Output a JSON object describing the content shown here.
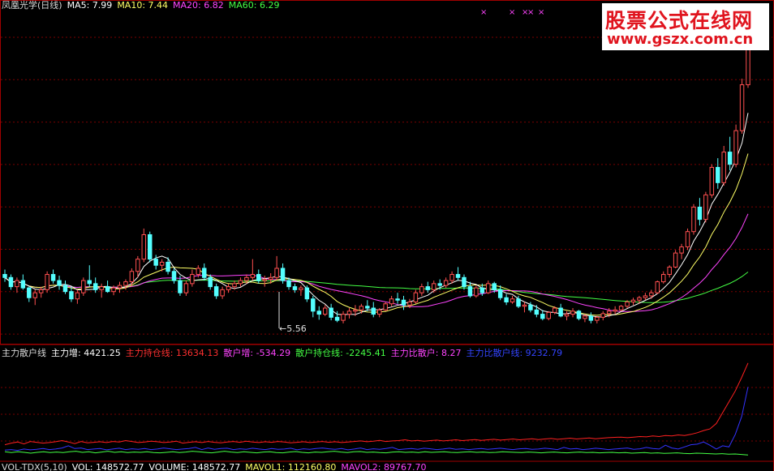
{
  "colors": {
    "background": "#000000",
    "grid": "#7a0000",
    "frame": "#a00000",
    "up": "#ff5050",
    "down": "#54ffff",
    "ma5": "#ffffff",
    "ma10": "#ffff66",
    "ma20": "#ff44ff",
    "ma60": "#44ff44",
    "ind_main": "#ff2020",
    "ind_retail": "#44ff44",
    "ind_blue": "#3333ff"
  },
  "header": {
    "title": "凤凰光学(日线)",
    "ma5": "MA5: 7.99",
    "ma10": "MA10: 7.44",
    "ma20": "MA20: 6.82",
    "ma60": "MA60: 6.29"
  },
  "markers": [
    "×",
    "×",
    "×",
    "×",
    "×"
  ],
  "watermark": {
    "line1": "股票公式在线网",
    "line2": "www.gszx.com.cn"
  },
  "low_label": "←5.56",
  "indicator_header": {
    "name": "主力散户线",
    "main_inc": "主力增: 4421.25",
    "main_hold": "主力持仓线: 13634.13",
    "retail_inc": "散户增: -534.29",
    "retail_hold": "散户持仓线: -2245.41",
    "ratio": "主力比散户: 8.27",
    "ratio_line": "主力比散户线: 9232.79"
  },
  "volume_header": {
    "name": "VOL-TDX(5,10)",
    "vol": "VOL: 148572.77",
    "volume": "VOLUME: 148572.77",
    "mavol1": "MAVOL1: 112160.80",
    "mavol2": "MAVOL2: 89767.70"
  },
  "chart_data": [
    {
      "type": "candlestick",
      "title": "凤凰光学(日线)",
      "y_unit": "price",
      "annotations": [
        "←5.56"
      ],
      "ma_values": {
        "MA5": 7.99,
        "MA10": 7.44,
        "MA20": 6.82,
        "MA60": 6.29
      },
      "low_marked": 5.56,
      "candles_ohlc": [
        [
          6.3,
          6.38,
          6.18,
          6.25
        ],
        [
          6.25,
          6.3,
          6.05,
          6.1
        ],
        [
          6.1,
          6.25,
          6.0,
          6.2
        ],
        [
          6.2,
          6.3,
          6.05,
          6.08
        ],
        [
          6.08,
          6.1,
          5.85,
          5.92
        ],
        [
          5.92,
          6.05,
          5.8,
          6.0
        ],
        [
          6.0,
          6.1,
          5.92,
          6.05
        ],
        [
          6.05,
          6.35,
          6.0,
          6.3
        ],
        [
          6.3,
          6.38,
          6.15,
          6.2
        ],
        [
          6.2,
          6.28,
          6.05,
          6.12
        ],
        [
          6.12,
          6.2,
          5.98,
          6.02
        ],
        [
          6.02,
          6.1,
          5.85,
          5.9
        ],
        [
          5.9,
          6.05,
          5.82,
          6.0
        ],
        [
          6.0,
          6.25,
          5.95,
          6.2
        ],
        [
          6.2,
          6.45,
          6.1,
          6.15
        ],
        [
          6.15,
          6.25,
          6.0,
          6.05
        ],
        [
          6.05,
          6.15,
          5.92,
          6.1
        ],
        [
          6.1,
          6.2,
          6.0,
          6.02
        ],
        [
          6.02,
          6.12,
          5.96,
          6.08
        ],
        [
          6.08,
          6.18,
          6.0,
          6.12
        ],
        [
          6.12,
          6.22,
          6.05,
          6.18
        ],
        [
          6.18,
          6.4,
          6.1,
          6.35
        ],
        [
          6.35,
          6.6,
          6.25,
          6.55
        ],
        [
          6.55,
          7.05,
          6.5,
          6.95
        ],
        [
          6.95,
          7.0,
          6.5,
          6.55
        ],
        [
          6.55,
          6.62,
          6.38,
          6.45
        ],
        [
          6.45,
          6.55,
          6.35,
          6.5
        ],
        [
          6.5,
          6.58,
          6.3,
          6.35
        ],
        [
          6.35,
          6.4,
          6.15,
          6.2
        ],
        [
          6.2,
          6.28,
          5.95,
          6.0
        ],
        [
          6.0,
          6.2,
          5.95,
          6.15
        ],
        [
          6.15,
          6.38,
          6.1,
          6.3
        ],
        [
          6.3,
          6.45,
          6.25,
          6.4
        ],
        [
          6.4,
          6.48,
          6.2,
          6.25
        ],
        [
          6.25,
          6.3,
          6.05,
          6.1
        ],
        [
          6.1,
          6.15,
          5.9,
          5.95
        ],
        [
          5.95,
          6.1,
          5.9,
          6.05
        ],
        [
          6.05,
          6.15,
          6.0,
          6.1
        ],
        [
          6.1,
          6.2,
          6.05,
          6.15
        ],
        [
          6.15,
          6.25,
          6.1,
          6.2
        ],
        [
          6.2,
          6.3,
          6.15,
          6.25
        ],
        [
          6.25,
          6.55,
          6.2,
          6.3
        ],
        [
          6.3,
          6.38,
          6.15,
          6.2
        ],
        [
          6.2,
          6.28,
          6.1,
          6.22
        ],
        [
          6.22,
          6.32,
          6.15,
          6.25
        ],
        [
          6.25,
          6.6,
          6.2,
          6.4
        ],
        [
          6.4,
          6.48,
          6.15,
          6.2
        ],
        [
          6.2,
          6.25,
          6.05,
          6.1
        ],
        [
          6.1,
          6.15,
          6.0,
          6.05
        ],
        [
          6.05,
          6.12,
          5.95,
          6.08
        ],
        [
          6.08,
          6.12,
          5.85,
          5.9
        ],
        [
          5.9,
          5.95,
          5.6,
          5.7
        ],
        [
          5.7,
          5.78,
          5.56,
          5.65
        ],
        [
          5.65,
          5.8,
          5.62,
          5.75
        ],
        [
          5.75,
          5.82,
          5.55,
          5.6
        ],
        [
          5.6,
          5.7,
          5.52,
          5.55
        ],
        [
          5.55,
          5.7,
          5.5,
          5.65
        ],
        [
          5.65,
          5.75,
          5.58,
          5.7
        ],
        [
          5.7,
          5.8,
          5.62,
          5.72
        ],
        [
          5.72,
          5.82,
          5.66,
          5.78
        ],
        [
          5.78,
          5.88,
          5.7,
          5.75
        ],
        [
          5.75,
          5.85,
          5.6,
          5.65
        ],
        [
          5.65,
          5.75,
          5.6,
          5.72
        ],
        [
          5.72,
          5.85,
          5.7,
          5.82
        ],
        [
          5.82,
          5.95,
          5.78,
          5.9
        ],
        [
          5.9,
          6.0,
          5.82,
          5.88
        ],
        [
          5.88,
          5.95,
          5.72,
          5.8
        ],
        [
          5.8,
          5.9,
          5.75,
          5.85
        ],
        [
          5.85,
          6.05,
          5.82,
          6.0
        ],
        [
          6.0,
          6.15,
          5.95,
          6.1
        ],
        [
          6.1,
          6.18,
          6.0,
          6.05
        ],
        [
          6.05,
          6.2,
          6.0,
          6.15
        ],
        [
          6.15,
          6.22,
          6.05,
          6.12
        ],
        [
          6.12,
          6.25,
          6.08,
          6.2
        ],
        [
          6.2,
          6.35,
          6.15,
          6.3
        ],
        [
          6.3,
          6.42,
          6.2,
          6.25
        ],
        [
          6.25,
          6.3,
          6.05,
          6.1
        ],
        [
          6.1,
          6.18,
          5.92,
          5.95
        ],
        [
          5.95,
          6.12,
          5.92,
          6.08
        ],
        [
          6.08,
          6.15,
          5.95,
          6.0
        ],
        [
          6.0,
          6.2,
          5.98,
          6.15
        ],
        [
          6.15,
          6.18,
          6.0,
          6.05
        ],
        [
          6.05,
          6.12,
          5.88,
          5.92
        ],
        [
          5.92,
          5.98,
          5.8,
          5.85
        ],
        [
          5.85,
          5.95,
          5.82,
          5.9
        ],
        [
          5.9,
          5.95,
          5.75,
          5.78
        ],
        [
          5.78,
          5.85,
          5.68,
          5.8
        ],
        [
          5.8,
          5.85,
          5.68,
          5.72
        ],
        [
          5.72,
          5.8,
          5.6,
          5.65
        ],
        [
          5.65,
          5.72,
          5.55,
          5.58
        ],
        [
          5.58,
          5.7,
          5.55,
          5.68
        ],
        [
          5.68,
          5.78,
          5.65,
          5.75
        ],
        [
          5.75,
          5.82,
          5.6,
          5.62
        ],
        [
          5.62,
          5.7,
          5.55,
          5.65
        ],
        [
          5.65,
          5.75,
          5.6,
          5.7
        ],
        [
          5.7,
          5.72,
          5.55,
          5.58
        ],
        [
          5.58,
          5.65,
          5.52,
          5.62
        ],
        [
          5.62,
          5.68,
          5.5,
          5.55
        ],
        [
          5.55,
          5.62,
          5.5,
          5.6
        ],
        [
          5.6,
          5.7,
          5.55,
          5.66
        ],
        [
          5.66,
          5.75,
          5.6,
          5.7
        ],
        [
          5.7,
          5.78,
          5.65,
          5.72
        ],
        [
          5.72,
          5.8,
          5.7,
          5.78
        ],
        [
          5.78,
          5.88,
          5.75,
          5.85
        ],
        [
          5.85,
          5.92,
          5.8,
          5.88
        ],
        [
          5.88,
          5.95,
          5.82,
          5.92
        ],
        [
          5.92,
          6.0,
          5.88,
          5.95
        ],
        [
          5.95,
          6.05,
          5.9,
          6.0
        ],
        [
          6.0,
          6.2,
          5.98,
          6.18
        ],
        [
          6.18,
          6.35,
          6.15,
          6.3
        ],
        [
          6.3,
          6.45,
          6.25,
          6.42
        ],
        [
          6.42,
          6.7,
          6.4,
          6.65
        ],
        [
          6.65,
          6.8,
          6.55,
          6.75
        ],
        [
          6.75,
          7.05,
          6.7,
          7.0
        ],
        [
          7.0,
          7.45,
          6.95,
          7.4
        ],
        [
          7.4,
          7.55,
          7.1,
          7.2
        ],
        [
          7.2,
          7.65,
          7.15,
          7.6
        ],
        [
          7.6,
          8.1,
          7.55,
          8.05
        ],
        [
          8.05,
          8.2,
          7.7,
          7.8
        ],
        [
          7.8,
          8.4,
          7.75,
          8.3
        ],
        [
          8.3,
          8.55,
          8.0,
          8.1
        ],
        [
          8.1,
          8.75,
          8.05,
          8.65
        ],
        [
          8.65,
          9.5,
          8.6,
          9.4
        ],
        [
          9.4,
          10.3,
          9.35,
          10.25
        ]
      ]
    },
    {
      "type": "line",
      "title": "主力散户线",
      "series": [
        {
          "name": "主力持仓线",
          "values": [
            -1400,
            -1100,
            -900,
            -1250,
            -800,
            -950,
            -1100,
            -1000,
            -850,
            -650,
            -900,
            -1200,
            -800,
            -1050,
            -950,
            -850,
            -1000,
            -800,
            -900,
            -650,
            -800,
            -1000,
            -900,
            -750,
            -850,
            -1000,
            -900,
            -750,
            -1100,
            -950,
            -850,
            -1000,
            -800,
            -950,
            -1050,
            -900,
            -800,
            -950,
            -750,
            -900,
            -1000,
            -850,
            -950,
            -800,
            -900,
            -1050,
            -950,
            -850,
            -1000,
            -900,
            -800,
            -950,
            -850,
            -1000,
            -900,
            -800,
            -700,
            -850,
            -750,
            -600,
            -800,
            -700,
            -650,
            -500,
            -700,
            -600,
            -750,
            -650,
            -550,
            -700,
            -600,
            -500,
            -650,
            -550,
            -450,
            -600,
            -500,
            -400,
            -550,
            -450,
            -350,
            -500,
            -400,
            -300,
            -450,
            -350,
            -250,
            -400,
            -300,
            -200,
            -350,
            -250,
            -150,
            -300,
            -200,
            -100,
            -50,
            0,
            -100,
            0,
            100,
            50,
            200,
            100,
            300,
            200,
            400,
            300,
            500,
            800,
            1200,
            1500,
            2500,
            4500,
            6500,
            8500,
            11000,
            13634
          ]
        },
        {
          "name": "散户持仓线",
          "values": [
            -2700,
            -2850,
            -2700,
            -2800,
            -2950,
            -2800,
            -2700,
            -2850,
            -2750,
            -2850,
            -2700,
            -2600,
            -2800,
            -2700,
            -2900,
            -2750,
            -2600,
            -2800,
            -2700,
            -2850,
            -2750,
            -2800,
            -2700,
            -2850,
            -2900,
            -2800,
            -2700,
            -2850,
            -2750,
            -2600,
            -2700,
            -2800,
            -2900,
            -2750,
            -2600,
            -2750,
            -2850,
            -2700,
            -2800,
            -2900,
            -2750,
            -2700,
            -2850,
            -2900,
            -2750,
            -2650,
            -2800,
            -2900,
            -2750,
            -2800,
            -2700,
            -2600,
            -2750,
            -2850,
            -2700,
            -2650,
            -2800,
            -2750,
            -2850,
            -2900,
            -2750,
            -2700,
            -2800,
            -2750,
            -2850,
            -2700,
            -2800,
            -2750,
            -2700,
            -2800,
            -2850,
            -2750,
            -2700,
            -2800,
            -2750,
            -2850,
            -2800,
            -2700,
            -2750,
            -2800,
            -2850,
            -2750,
            -2800,
            -2900,
            -2800,
            -2750,
            -2850,
            -2900,
            -2800,
            -2750,
            -2850,
            -2800,
            -2900,
            -2850,
            -2800,
            -2900,
            -2850,
            -2950,
            -2900,
            -2850,
            -2950,
            -2900,
            -3000,
            -2950,
            -2900,
            -3000,
            -3050,
            -2950,
            -3000,
            -3050,
            -3100,
            -3050,
            -3150,
            -3100,
            -3200,
            -3300
          ]
        },
        {
          "name": "主力比散户线",
          "values": [
            -2400,
            -2300,
            -2450,
            -2200,
            -2350,
            -2250,
            -2100,
            -2300,
            -2200,
            -2000,
            -1600,
            -2100,
            -2000,
            -2300,
            -2200,
            -2100,
            -2350,
            -2200,
            -2050,
            -2300,
            -2150,
            -2250,
            -2100,
            -2300,
            -2200,
            -2000,
            -2150,
            -2300,
            -2200,
            -2100,
            -1900,
            -2300,
            -2000,
            -2250,
            -2100,
            -2050,
            -2300,
            -2150,
            -2250,
            -2050,
            -2200,
            -2300,
            -2100,
            -2250,
            -2200,
            -2050,
            -2350,
            -2150,
            -2250,
            -2100,
            -2000,
            -2150,
            -2250,
            -2100,
            -2350,
            -2200,
            -2000,
            -2300,
            -2150,
            -2250,
            -2100,
            -1900,
            -2300,
            -2200,
            -2100,
            -2250,
            -2050,
            -2150,
            -2300,
            -2200,
            -2050,
            -2250,
            -2150,
            -2300,
            -2200,
            -2100,
            -2250,
            -2150,
            -2050,
            -2200,
            -2300,
            -2150,
            -2100,
            -2250,
            -2200,
            -2050,
            -2150,
            -2300,
            -1900,
            -2200,
            -2100,
            -2300,
            -2200,
            -2050,
            -2150,
            -2300,
            -2200,
            -2100,
            -2000,
            -2250,
            -2150,
            -1900,
            -2100,
            -2200,
            -1500,
            -2000,
            -2200,
            -1800,
            -1400,
            -1300,
            -900,
            -1500,
            -2200,
            -1600,
            -1800,
            500,
            3800,
            9233
          ]
        }
      ]
    }
  ]
}
